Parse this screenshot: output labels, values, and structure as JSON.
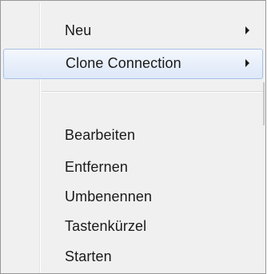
{
  "context_menu": {
    "items": [
      {
        "label": "Neu",
        "has_submenu": true,
        "highlighted": false
      },
      {
        "label": "Clone Connection",
        "has_submenu": true,
        "highlighted": true
      },
      {
        "label": "Bearbeiten",
        "has_submenu": false,
        "highlighted": false
      },
      {
        "label": "Entfernen",
        "has_submenu": false,
        "highlighted": false
      },
      {
        "label": "Umbenennen",
        "has_submenu": false,
        "highlighted": false
      },
      {
        "label": "Tastenkürzel",
        "has_submenu": false,
        "highlighted": false
      },
      {
        "label": "Starten",
        "has_submenu": false,
        "highlighted": false
      }
    ],
    "highlight_color": "#dde8f8",
    "highlight_border_color": "#a8c0e6",
    "background_color": "#f0f0f0"
  }
}
